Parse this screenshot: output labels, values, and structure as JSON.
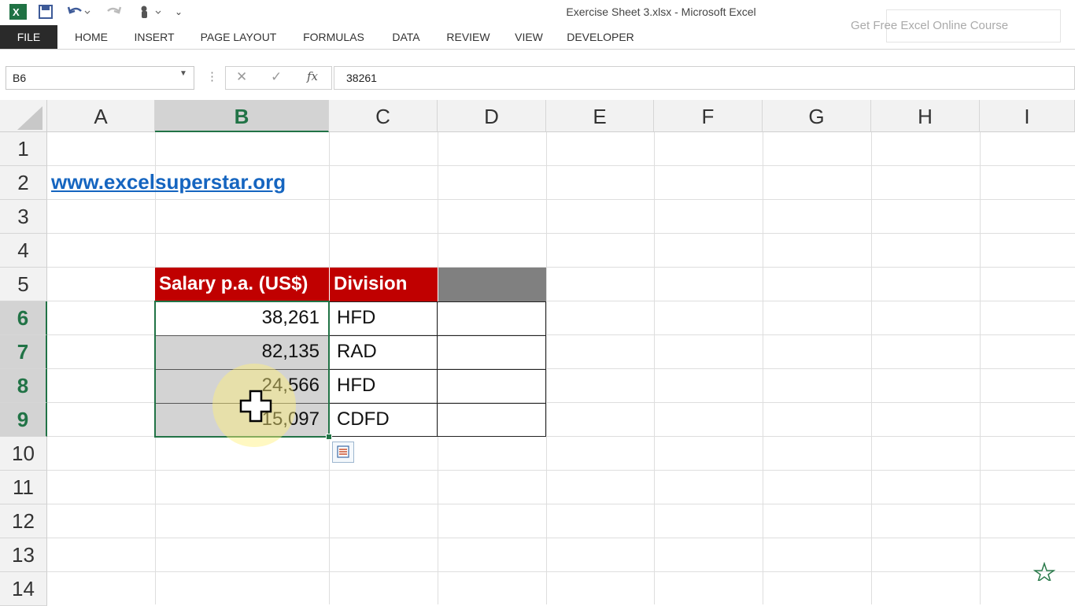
{
  "app": {
    "title": "Exercise Sheet 3.xlsx - Microsoft Excel",
    "promo": "Get Free Excel Online Course",
    "tabs": [
      "FILE",
      "HOME",
      "INSERT",
      "PAGE LAYOUT",
      "FORMULAS",
      "DATA",
      "REVIEW",
      "VIEW",
      "DEVELOPER"
    ]
  },
  "formula_bar": {
    "name_box": "B6",
    "formula": "38261",
    "fx": "fx"
  },
  "columns": [
    "A",
    "B",
    "C",
    "D",
    "E",
    "F",
    "G",
    "H",
    "I"
  ],
  "rows": [
    "1",
    "2",
    "3",
    "4",
    "5",
    "6",
    "7",
    "8",
    "9",
    "10",
    "11",
    "12",
    "13",
    "14"
  ],
  "sheet": {
    "link": "www.excelsuperstar.org",
    "header_salary": "Salary p.a. (US$)",
    "header_division": "Division",
    "data": [
      {
        "salary": "38,261",
        "division": "HFD"
      },
      {
        "salary": "82,135",
        "division": "RAD"
      },
      {
        "salary": "24,566",
        "division": "HFD"
      },
      {
        "salary": "15,097",
        "division": "CDFD"
      }
    ]
  },
  "colors": {
    "header_fill": "#c00000",
    "selection_accent": "#217346",
    "empty_header_fill": "#808080"
  }
}
